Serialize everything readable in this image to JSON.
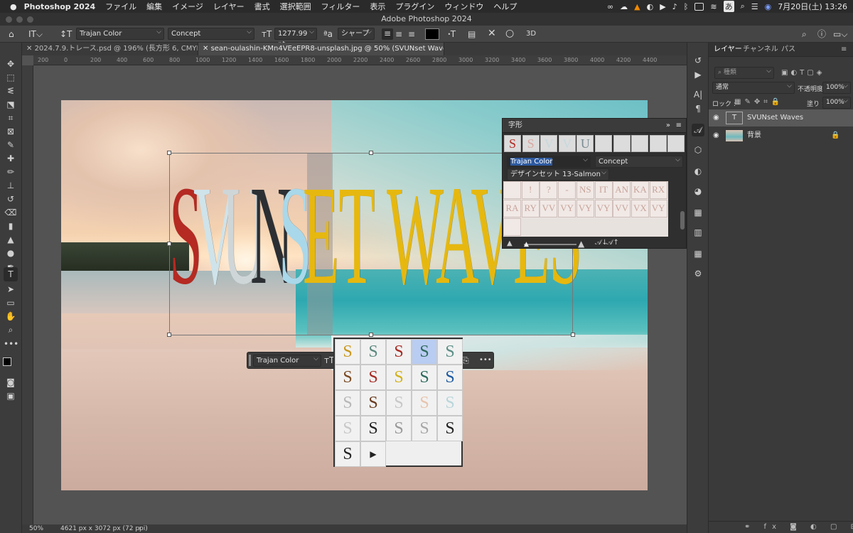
{
  "menubar": {
    "app": "Photoshop 2024",
    "items": [
      "ファイル",
      "編集",
      "イメージ",
      "レイヤー",
      "書式",
      "選択範囲",
      "フィルター",
      "表示",
      "プラグイン",
      "ウィンドウ",
      "ヘルプ"
    ],
    "date_time": "7月20日(土) 13:26",
    "ime": "あ"
  },
  "window_title": "Adobe Photoshop 2024",
  "options": {
    "font_family": "Trajan Color",
    "font_style": "Concept",
    "font_size": "1277.99 pt",
    "antialias": "シャープ",
    "share": "共有",
    "three_d": "3D"
  },
  "tabs": [
    {
      "label": "2024.7.9.トレース.psd @ 196% (長方形 6, CMYK/8) *"
    },
    {
      "label": "sean-oulashin-KMn4VEeEPR8-unsplash.jpg @ 50% (SVUNset Waves, RGB/8) *"
    }
  ],
  "ruler_ticks": [
    "200",
    "0",
    "200",
    "400",
    "600",
    "800",
    "1000",
    "1200",
    "1400",
    "1600",
    "1800",
    "2000",
    "2200",
    "2400",
    "2600",
    "2800",
    "3000",
    "3200",
    "3400",
    "3600",
    "3800",
    "4000",
    "4200",
    "4400"
  ],
  "canvas_text": {
    "letters": [
      "S",
      "V",
      "U",
      "N",
      "S",
      "ET WAVES"
    ],
    "colors": [
      "#b52a22",
      "#cfe3ea",
      "#cfd6d8",
      "#2b2f33",
      "#a9d8ea",
      "#e6b80f"
    ]
  },
  "glyphs_panel": {
    "title": "字形",
    "recent": [
      "S",
      "S",
      "V",
      "V",
      "U"
    ],
    "recent_colors": [
      "#b52a22",
      "#d9a9a3",
      "#c8d8de",
      "#c8d8de",
      "#7a8c94"
    ],
    "font_family": "Trajan Color",
    "font_style": "Concept",
    "set": "デザインセット 13-Salmon",
    "grid_row1": [
      "",
      "!",
      "?",
      "-",
      "NS",
      "IT",
      "AN",
      "KA",
      "RX"
    ],
    "grid_row2": [
      "RA",
      "RY",
      "VV",
      "VY",
      "VY",
      "VY",
      "VV",
      "VX",
      "VY"
    ]
  },
  "context_bar": {
    "font": "Trajan Color",
    "more": "•••"
  },
  "alternates_popup": {
    "glyphs": [
      "S",
      "S",
      "S",
      "S",
      "S",
      "S",
      "S",
      "S",
      "S",
      "S",
      "S",
      "S",
      "S",
      "S",
      "S",
      "S",
      "S",
      "S",
      "S",
      "S",
      "S"
    ],
    "colors": [
      "#c9971c",
      "#5e8a80",
      "#a82b24",
      "#2f6a5b",
      "#5c8f86",
      "#7a4a22",
      "#a82b24",
      "#d1b21a",
      "#2e6b5e",
      "#1e5aa0",
      "#b8b8b8",
      "#6a3b1e",
      "#c8c8c8",
      "#e8c4ad",
      "#b9d6dc",
      "#c8c8c8",
      "#222222",
      "#9a9a9a",
      "#a8a8a8",
      "#222222",
      "#222222"
    ],
    "arrow": "▶"
  },
  "layers_panel": {
    "tabs": [
      "レイヤー",
      "チャンネル",
      "パス"
    ],
    "search_placeholder": "種類",
    "blend_mode": "通常",
    "opacity_label": "不透明度 :",
    "opacity": "100%",
    "lock_label": "ロック :",
    "fill_label": "塗り :",
    "fill": "100%",
    "layers": [
      {
        "name": "SVUNset Waves",
        "type": "text"
      },
      {
        "name": "背景",
        "type": "image"
      }
    ]
  },
  "status": {
    "zoom": "50%",
    "doc_size": "4621 px x 3072 px (72 ppi)"
  }
}
